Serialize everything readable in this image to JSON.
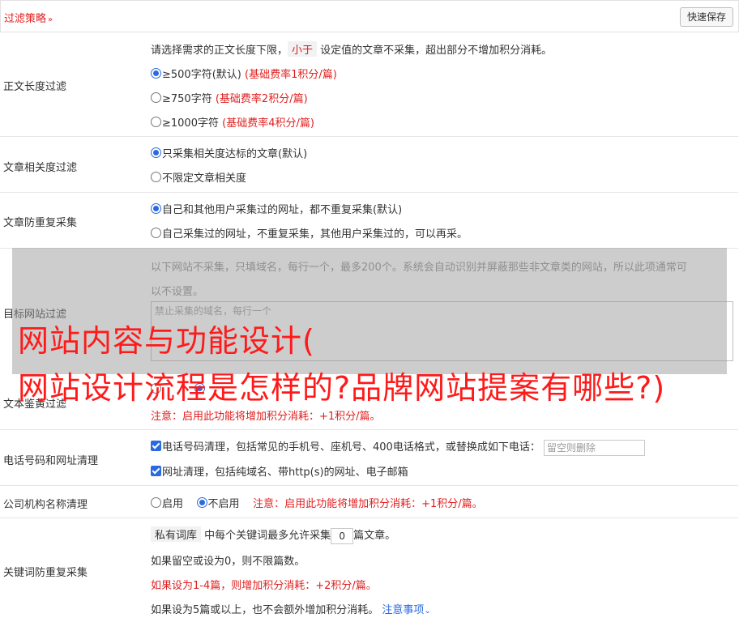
{
  "header": {
    "title": "过滤策略",
    "chevron": "»",
    "quick_save": "快速保存"
  },
  "length_filter": {
    "label": "正文长度过滤",
    "desc_pre": "请选择需求的正文长度下限，",
    "desc_tag": "小于",
    "desc_post": "设定值的文章不采集，超出部分不增加积分消耗。",
    "options": [
      {
        "text": "≥500字符(默认)",
        "note": "(基础费率1积分/篇)"
      },
      {
        "text": "≥750字符",
        "note": "(基础费率2积分/篇)"
      },
      {
        "text": "≥1000字符",
        "note": "(基础费率4积分/篇)"
      }
    ]
  },
  "relevance_filter": {
    "label": "文章相关度过滤",
    "options": [
      "只采集相关度达标的文章(默认)",
      "不限定文章相关度"
    ]
  },
  "dedupe": {
    "label": "文章防重复采集",
    "options": [
      "自己和其他用户采集过的网址，都不重复采集(默认)",
      "自己采集过的网址，不重复采集，其他用户采集过的，可以再采。"
    ]
  },
  "target_site": {
    "label": "目标网站过滤",
    "desc1": "以下网站不采集，只填域名，每行一个，最多200个。系统会自动识别并屏蔽那些非文章类的网站，所以此项通常可",
    "desc2": "以不设置。",
    "placeholder": "禁止采集的域名，每行一个"
  },
  "porn_filter": {
    "label": "文本鉴黄过滤",
    "note": "注意：启用此功能将增加积分消耗：+1积分/篇。"
  },
  "phone_clean": {
    "label": "电话号码和网址清理",
    "phone_text": "电话号码清理，包括常见的手机号、座机号、400电话格式，或替换成如下电话：",
    "phone_placeholder": "留空则删除",
    "url_text": "网址清理，包括纯域名、带http(s)的网址、电子邮箱"
  },
  "org_clean": {
    "label": "公司机构名称清理",
    "enable": "启用",
    "disable": "不启用",
    "note": "注意：启用此功能将增加积分消耗：+1积分/篇。"
  },
  "keyword_dedupe": {
    "label": "关键词防重复采集",
    "tag": "私有词库",
    "line1_pre": "中每个关键词最多允许采集",
    "line1_value": "0",
    "line1_post": "篇文章。",
    "line2": "如果留空或设为0，则不限篇数。",
    "line3": "如果设为1-4篇，则增加积分消耗：+2积分/篇。",
    "line4": "如果设为5篇或以上，也不会额外增加积分消耗。",
    "notes_link": "注意事项"
  },
  "watermark": {
    "line1": "网站内容与功能设计(",
    "line2": "网站设计流程是怎样的?品牌网站提案有哪些?)"
  }
}
